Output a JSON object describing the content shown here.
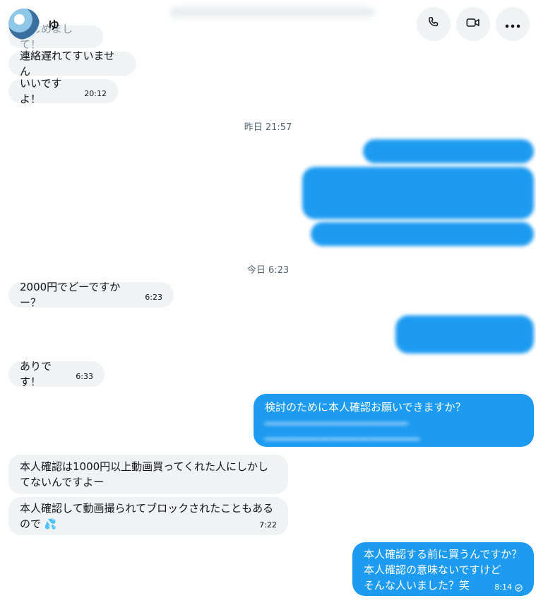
{
  "header": {
    "name": "ゆ"
  },
  "messages_day1": {
    "m1": "はじめまして！",
    "m2": "連絡遅れてすいません",
    "m3": "いいですよ！",
    "m3_time": "20:12"
  },
  "separators": {
    "yesterday": "昨日 21:57",
    "today": "今日 6:23"
  },
  "messages_day2": {
    "m1": "2000円でどーですかー？",
    "m1_time": "6:23",
    "m2": "ありです！",
    "m2_time": "6:33",
    "out_request_line1": "検討のために本人確認お願いできますか？",
    "m3_line1": "本人確認は1000円以上動画買ってくれた人にしかし",
    "m3_line2": "てないんですよー",
    "m4_line1": "本人確認して動画撮られてブロックされたこともある",
    "m4_line2": "ので",
    "m4_emoji": "💦",
    "m4_time": "7:22",
    "out_final_line1": "本人確認する前に買うんですか？",
    "out_final_line2": "本人確認の意味ないですけど",
    "out_final_line3": "そんな人いました？笑",
    "out_final_time": "8:14"
  },
  "icons": {
    "call": "phone-icon",
    "video": "video-camera-icon",
    "more": "more-horizontal-icon",
    "read": "read-check-icon"
  },
  "colors": {
    "outgoing": "#1d9bf0",
    "incoming": "#eff3f4",
    "button_bg": "#eff3f4"
  }
}
